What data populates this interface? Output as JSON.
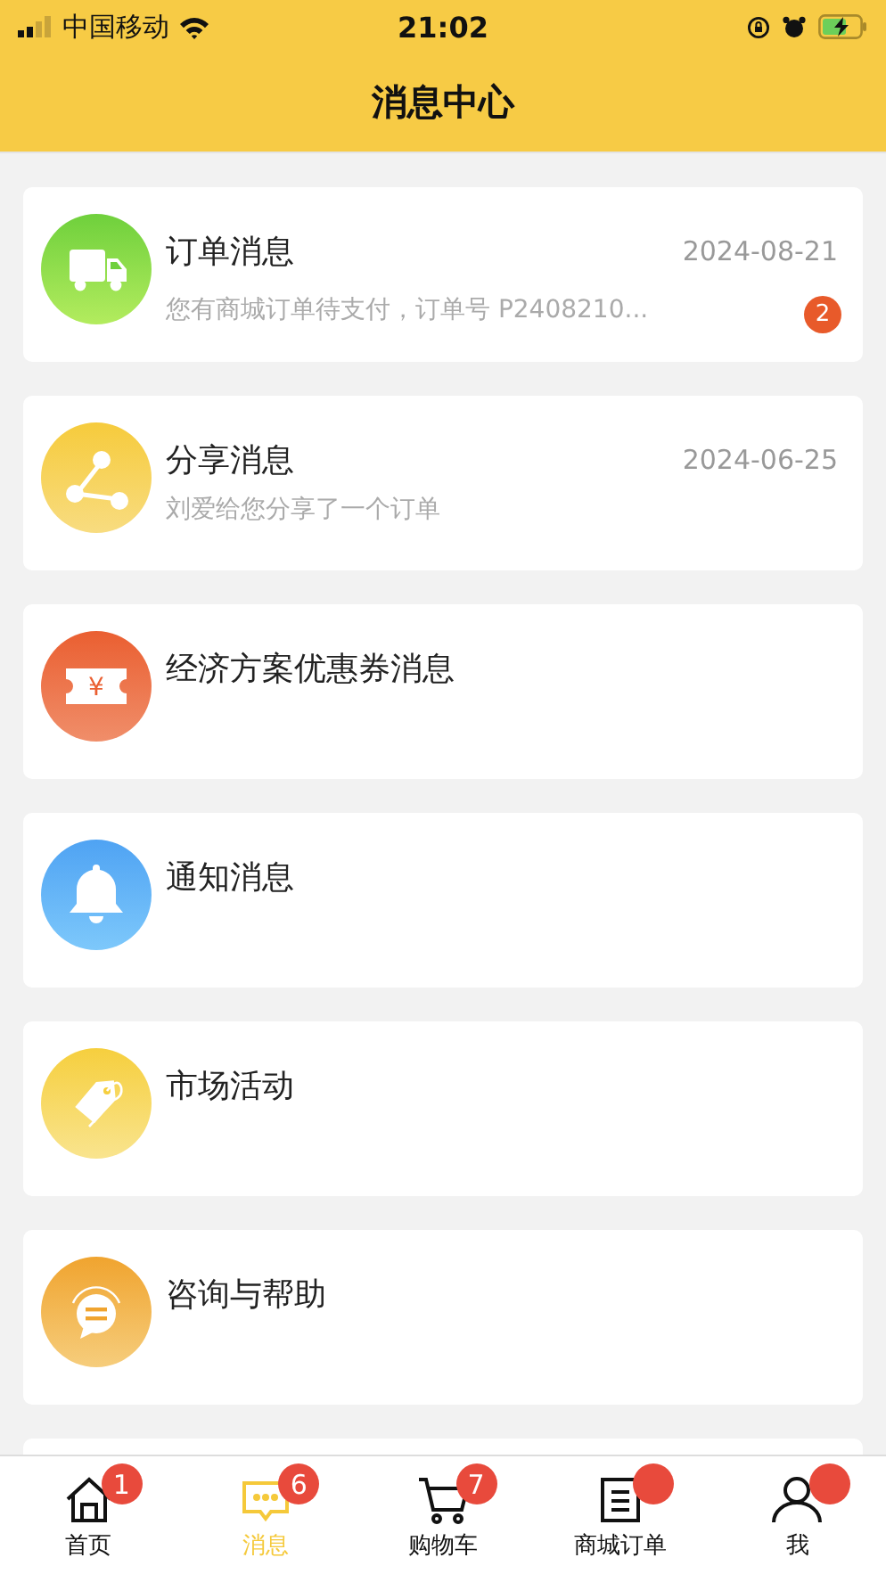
{
  "status_bar": {
    "carrier": "中国移动",
    "time": "21:02"
  },
  "header": {
    "title": "消息中心"
  },
  "messages": [
    {
      "kind": "truck",
      "title": "订单消息",
      "date": "2024-08-21",
      "preview": "您有商城订单待支付，订单号 P2408210...",
      "badge": "2"
    },
    {
      "kind": "share",
      "title": "分享消息",
      "date": "2024-06-25",
      "preview": "刘爱给您分享了一个订单"
    },
    {
      "kind": "coupon",
      "icon_glyph": "¥",
      "title": "经济方案优惠券消息"
    },
    {
      "kind": "bell",
      "title": "通知消息"
    },
    {
      "kind": "tag",
      "title": "市场活动"
    },
    {
      "kind": "chat",
      "title": "咨询与帮助"
    }
  ],
  "tab_bar": [
    {
      "kind": "home",
      "label": "首页",
      "selected": false,
      "badge": "1"
    },
    {
      "kind": "chat",
      "label": "消息",
      "selected": true,
      "badge": "6"
    },
    {
      "kind": "cart",
      "label": "购物车",
      "selected": false,
      "badge": "7"
    },
    {
      "kind": "list",
      "label": "商城订单",
      "selected": false,
      "dot": true
    },
    {
      "kind": "person",
      "label": "我",
      "selected": false,
      "dot": true
    }
  ]
}
